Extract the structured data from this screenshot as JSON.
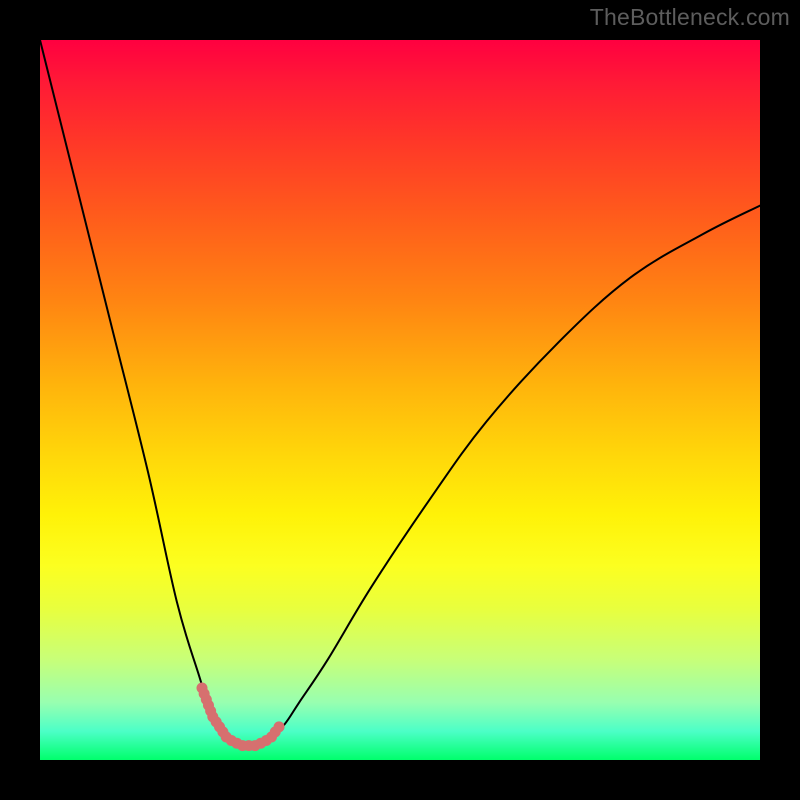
{
  "watermark": "TheBottleneck.com",
  "chart_data": {
    "type": "line",
    "title": "",
    "xlabel": "",
    "ylabel": "",
    "xlim": [
      0,
      100
    ],
    "ylim": [
      0,
      100
    ],
    "grid": false,
    "axes_hidden": true,
    "legend": false,
    "background_gradient": {
      "direction": "vertical",
      "stops": [
        {
          "pos": 0,
          "color": "#ff0040"
        },
        {
          "pos": 14,
          "color": "#ff3728"
        },
        {
          "pos": 36,
          "color": "#ff8412"
        },
        {
          "pos": 58,
          "color": "#ffd80a"
        },
        {
          "pos": 73,
          "color": "#fcff20"
        },
        {
          "pos": 86,
          "color": "#c8ff78"
        },
        {
          "pos": 100,
          "color": "#00ff6c"
        }
      ]
    },
    "series": [
      {
        "name": "bottleneck-curve",
        "x": [
          0,
          5,
          10,
          15,
          19,
          22,
          24,
          26,
          28,
          30,
          32,
          34,
          36,
          40,
          46,
          54,
          62,
          72,
          82,
          92,
          100
        ],
        "values": [
          100,
          80,
          60,
          40,
          22,
          12,
          6,
          3,
          2,
          2,
          3,
          5,
          8,
          14,
          24,
          36,
          47,
          58,
          67,
          73,
          77
        ],
        "stroke": "#000000",
        "stroke_width": 2
      },
      {
        "name": "valley-highlight",
        "x": [
          22.5,
          24,
          26,
          28,
          30,
          32,
          33.5
        ],
        "values": [
          10,
          6,
          3,
          2,
          2,
          3,
          5
        ],
        "stroke": "#d6706f",
        "stroke_width": 11,
        "dotted": true
      }
    ]
  }
}
